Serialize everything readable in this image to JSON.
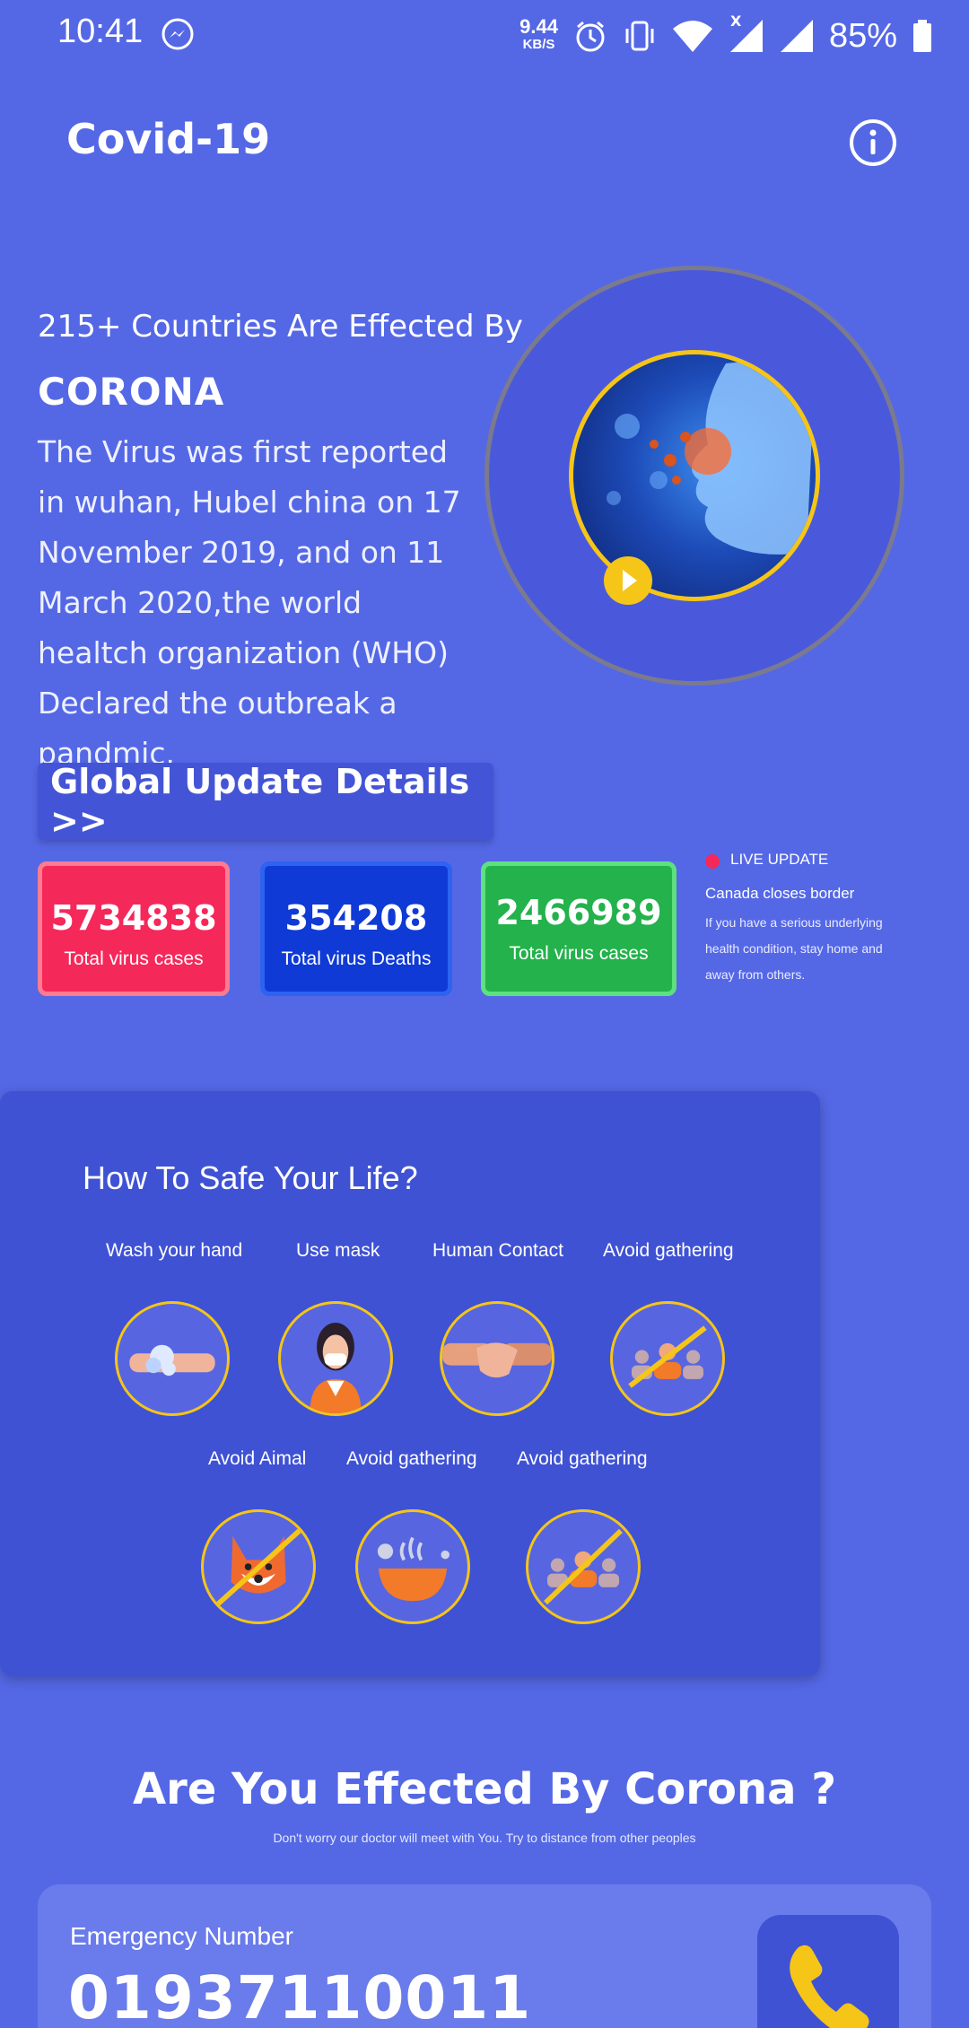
{
  "status_bar": {
    "time": "10:41",
    "speed_value": "9.44",
    "speed_unit": "KB/S",
    "battery": "85%",
    "network_label": "X"
  },
  "header": {
    "title": "Covid-19"
  },
  "hero": {
    "subtitle": "215+ Countries Are Effected By",
    "title": "CORONA",
    "body": "The Virus was first reported in wuhan, Hubel china on 17 November 2019, and on 11 March 2020,the world healtch organization (WHO) Declared the outbreak a pandmic."
  },
  "global_button": {
    "label": "Global Update Details >>"
  },
  "stats": [
    {
      "value": "5734838",
      "label": "Total virus cases",
      "color": "#f5285a"
    },
    {
      "value": "354208",
      "label": "Total virus Deaths",
      "color": "#0f3ad6"
    },
    {
      "value": "2466989",
      "label": "Total virus cases",
      "color": "#23b24b"
    }
  ],
  "live_update": {
    "title": "LIVE UPDATE",
    "headline": "Canada closes border",
    "body": "If you have a serious underlying health condition, stay home and away from others."
  },
  "safety": {
    "title": "How To Safe Your Life?",
    "tips_row1": [
      "Wash your hand",
      "Use mask",
      "Human Contact",
      "Avoid gathering"
    ],
    "tips_row2": [
      "Avoid Aimal",
      "Avoid gathering",
      "Avoid gathering"
    ]
  },
  "affected": {
    "title": "Are You Effected By Corona ?",
    "subtitle": "Don't worry our doctor will  meet with You. Try to distance from other peoples"
  },
  "emergency": {
    "label": "Emergency Number",
    "number": "01937110011"
  },
  "colors": {
    "background": "#5468e6",
    "card": "#3f52d4",
    "accent": "#f5c518"
  }
}
